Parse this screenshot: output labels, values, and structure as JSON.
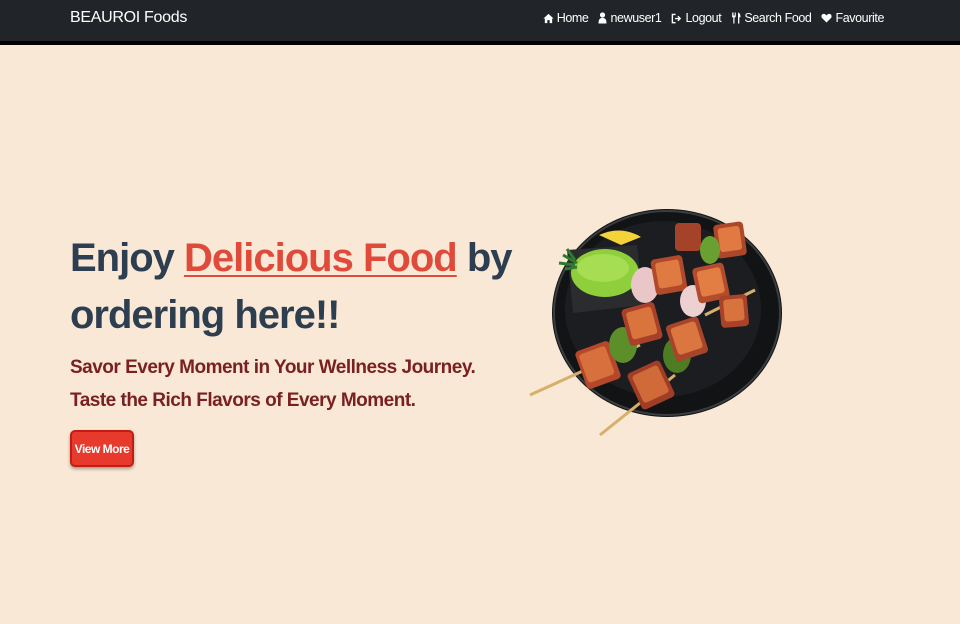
{
  "navbar": {
    "brand": "BEAUROI Foods",
    "links": [
      {
        "label": "Home",
        "icon": "home-icon"
      },
      {
        "label": "newuser1",
        "icon": "user-icon"
      },
      {
        "label": "Logout",
        "icon": "logout-icon"
      },
      {
        "label": "Search Food",
        "icon": "utensils-icon"
      },
      {
        "label": "Favourite",
        "icon": "heart-icon"
      }
    ]
  },
  "hero": {
    "title_prefix": "Enjoy ",
    "title_highlight": "Delicious Food",
    "title_suffix": " by ordering here!!",
    "subtitle": "Savor Every Moment in Your Wellness Journey. Taste the Rich Flavors of Every Moment.",
    "button_label": "View More"
  },
  "colors": {
    "background": "#f9e8d5",
    "navbar": "#212529",
    "title": "#2d3e50",
    "highlight": "#e04a3a",
    "subtitle": "#7a2020",
    "button": "#e8392d"
  }
}
